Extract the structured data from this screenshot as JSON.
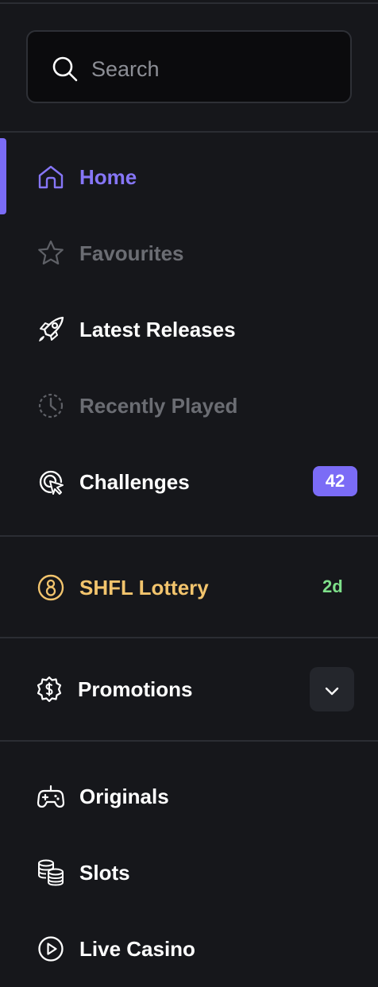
{
  "search": {
    "placeholder": "Search"
  },
  "nav": {
    "home": "Home",
    "favourites": "Favourites",
    "latest_releases": "Latest Releases",
    "recently_played": "Recently Played",
    "challenges": "Challenges",
    "challenges_badge": "42"
  },
  "lottery": {
    "label": "SHFL Lottery",
    "timer": "2d"
  },
  "promotions": {
    "label": "Promotions"
  },
  "categories": {
    "originals": "Originals",
    "slots": "Slots",
    "live_casino": "Live Casino"
  },
  "colors": {
    "background": "#16171b",
    "accent": "#7b6cf6",
    "lottery": "#f2c46d",
    "timer": "#7ee08a",
    "muted": "#6b6d73"
  }
}
